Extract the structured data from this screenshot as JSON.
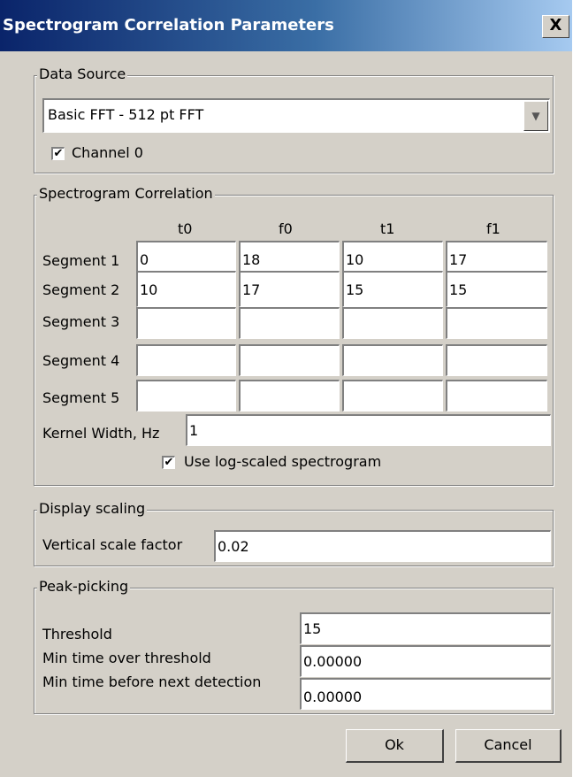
{
  "dialog": {
    "title": "Spectrogram Correlation Parameters",
    "close_label": "X"
  },
  "data_source": {
    "legend": "Data Source",
    "selected": "Basic FFT - 512 pt FFT",
    "channel_label": "Channel 0",
    "channel_checked": true
  },
  "correlation": {
    "legend": "Spectrogram Correlation",
    "columns": [
      "t0",
      "f0",
      "t1",
      "f1"
    ],
    "rows": [
      {
        "label": "Segment 1",
        "values": [
          "0",
          "18",
          "10",
          "17"
        ]
      },
      {
        "label": "Segment 2",
        "values": [
          "10",
          "17",
          "15",
          "15"
        ]
      },
      {
        "label": "Segment 3",
        "values": [
          "",
          "",
          "",
          ""
        ]
      },
      {
        "label": "Segment 4",
        "values": [
          "",
          "",
          "",
          ""
        ]
      },
      {
        "label": "Segment 5",
        "values": [
          "",
          "",
          "",
          ""
        ]
      }
    ],
    "kernel_label": "Kernel Width, Hz",
    "kernel_value": "1",
    "log_label": "Use log-scaled spectrogram",
    "log_checked": true
  },
  "display": {
    "legend": "Display scaling",
    "vscale_label": "Vertical scale factor",
    "vscale_value": "0.02"
  },
  "peak": {
    "legend": "Peak-picking",
    "threshold_label": "Threshold",
    "threshold_value": "15",
    "min_over_label": "Min time over threshold",
    "min_over_value": "0.00000",
    "min_before_label": "Min time before next detection",
    "min_before_value": "0.00000"
  },
  "buttons": {
    "ok": "Ok",
    "cancel": "Cancel"
  }
}
